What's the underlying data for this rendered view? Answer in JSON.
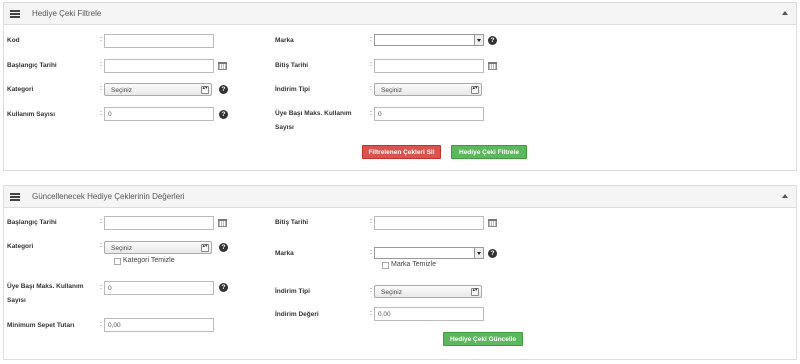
{
  "filter_panel": {
    "title": "Hediye Çeki Filtrele",
    "fields": {
      "kod": {
        "label": "Kod",
        "value": ""
      },
      "marka": {
        "label": "Marka",
        "value": ""
      },
      "baslangic": {
        "label": "Başlangıç Tarihi",
        "value": ""
      },
      "bitis": {
        "label": "Bitiş Tarihi",
        "value": ""
      },
      "kategori": {
        "label": "Kategori",
        "value": "Seçiniz"
      },
      "indirim_tipi": {
        "label": "İndirim Tipi",
        "value": "Seçiniz"
      },
      "kullanim_sayisi": {
        "label": "Kullanım Sayısı",
        "value": "0"
      },
      "uye_basi_line1": "Üye Başı Maks. Kullanım",
      "uye_basi_line2": "Sayısı",
      "uye_basi_value": "0"
    },
    "buttons": {
      "clear": "Filtrelenen Çekleri Sil",
      "filter": "Hediye Çeki Filtrele"
    }
  },
  "update_panel": {
    "title": "Güncellenecek Hediye Çeklerinin Değerleri",
    "fields": {
      "baslangic": {
        "label": "Başlangıç Tarihi",
        "value": ""
      },
      "bitis": {
        "label": "Bitiş Tarihi",
        "value": ""
      },
      "kategori": {
        "label": "Kategori",
        "value": "Seçiniz"
      },
      "kategori_temizle": "Kategori Temizle",
      "marka": {
        "label": "Marka",
        "value": ""
      },
      "marka_temizle": "Marka Temizle",
      "uye_basi_line1": "Üye Başı Maks. Kullanım",
      "uye_basi_line2": "Sayısı",
      "uye_basi_value": "0",
      "indirim_tipi": {
        "label": "İndirim Tipi",
        "value": "Seçiniz"
      },
      "indirim_degeri": {
        "label": "İndirim Değeri",
        "value": "0,00"
      },
      "min_sepet": {
        "label": "Minimum Sepet Tutarı",
        "value": "0,00"
      }
    },
    "buttons": {
      "update": "Hediye Çeki Güncelle"
    }
  },
  "common": {
    "colon": ":",
    "help": "?"
  },
  "colors": {
    "header_bg": "#f5f5f5",
    "red_button": "#d9534f",
    "green_button": "#5cb85c"
  }
}
